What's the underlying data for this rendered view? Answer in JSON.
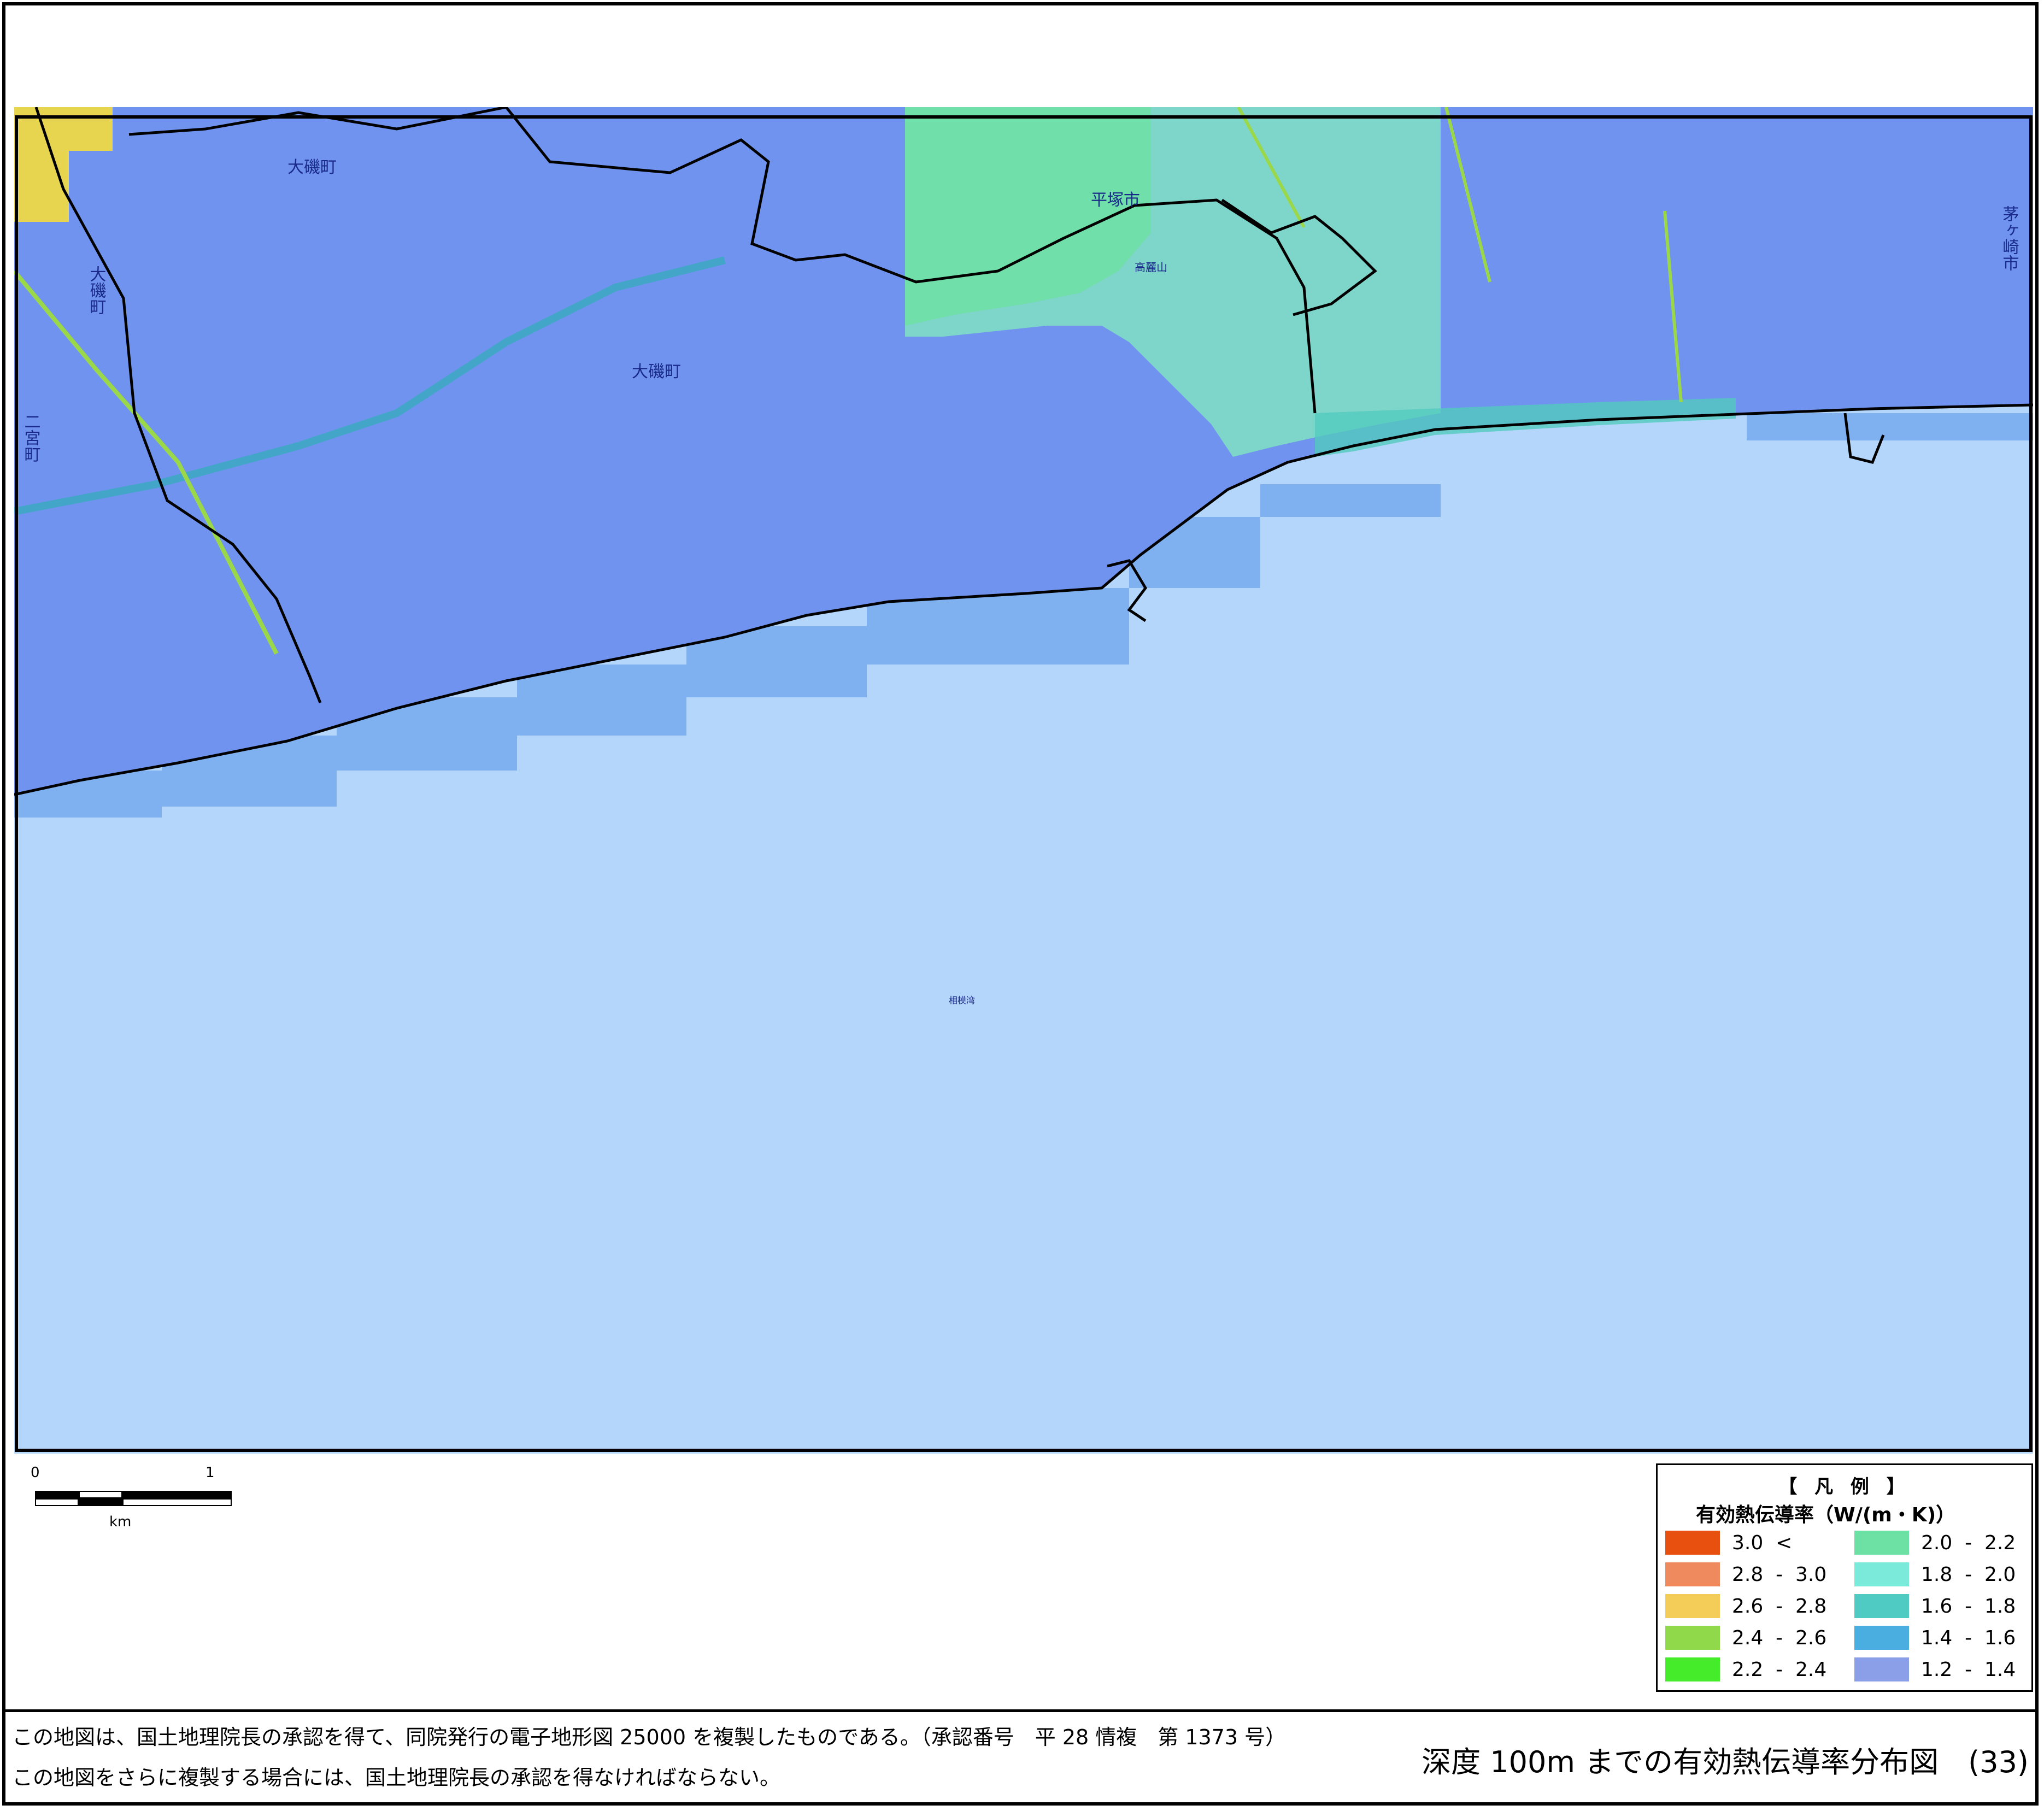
{
  "map": {
    "place_labels": [
      {
        "id": "oiso-1",
        "text": "大磯町"
      },
      {
        "id": "oiso-2",
        "text": "大磯町"
      },
      {
        "id": "oiso-3",
        "text": "大磯町"
      },
      {
        "id": "hiratsuka",
        "text": "平塚市"
      },
      {
        "id": "ninomiya",
        "text": "二宮町"
      },
      {
        "id": "chigasaki",
        "text": "茅ヶ崎市"
      },
      {
        "id": "takatoriyama",
        "text": "高麗山"
      },
      {
        "id": "sagami-bay",
        "text": "相模湾"
      }
    ],
    "colors": {
      "sea": "#b5d6fb",
      "coastal_sea": "#7fb0f0",
      "class_1_2_to_1_4": "#6f93ee",
      "class_1_4_to_1_6": "#57b8e0",
      "class_1_6_to_1_8": "#52cbbf",
      "class_1_8_to_2_0": "#7de2cc",
      "class_2_0_to_2_2": "#6de0a3",
      "class_2_6_to_2_8": "#e7d44f",
      "boundary": "#000000",
      "road": "#9ad84a"
    }
  },
  "scalebar": {
    "zero": "0",
    "one": "1",
    "unit": "km"
  },
  "legend": {
    "title": "【 凡 例 】",
    "subtitle": "有効熱伝導率（W/(m・K)）",
    "items": [
      {
        "label": "3.0  <",
        "color": "#e8500f"
      },
      {
        "label": "2.8  -  3.0",
        "color": "#ee8a5e"
      },
      {
        "label": "2.6  -  2.8",
        "color": "#f3cd57"
      },
      {
        "label": "2.4  -  2.6",
        "color": "#8fd94a"
      },
      {
        "label": "2.2  -  2.4",
        "color": "#45ec2a"
      },
      {
        "label": "2.0  -  2.2",
        "color": "#6de0a3"
      },
      {
        "label": "1.8  -  2.0",
        "color": "#7ceadb"
      },
      {
        "label": "1.6  -  1.8",
        "color": "#4fcbc3"
      },
      {
        "label": "1.4  -  1.6",
        "color": "#4aaee0"
      },
      {
        "label": "1.2  -  1.4",
        "color": "#8b9fe8"
      }
    ]
  },
  "footer": {
    "note_1": "この地図は、国土地理院長の承認を得て、同院発行の電子地形図 25000 を複製したものである。（承認番号　平 28 情複　第 1373 号）",
    "note_2": "この地図をさらに複製する場合には、国土地理院長の承認を得なければならない。",
    "title": "深度 100m までの有効熱伝導率分布図　(33)"
  }
}
